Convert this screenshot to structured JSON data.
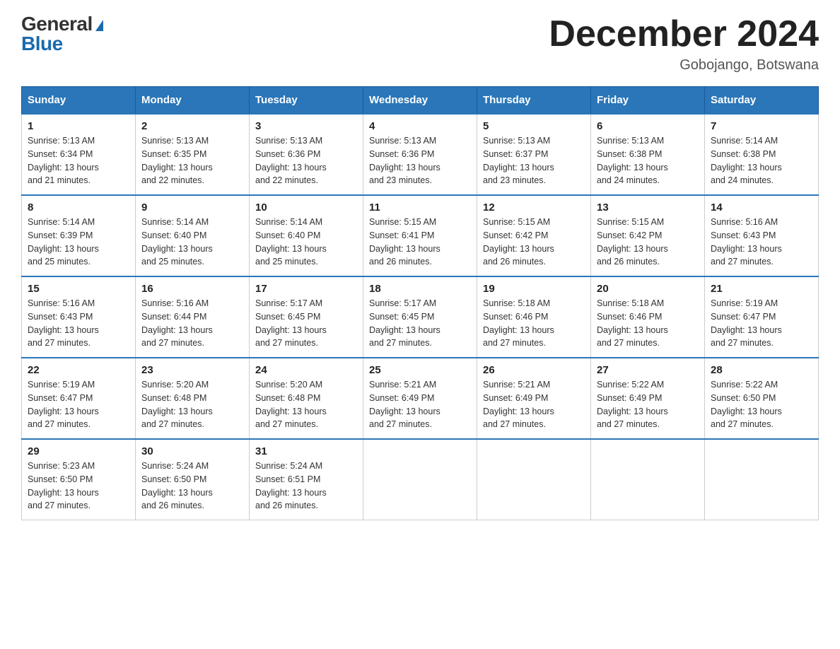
{
  "logo": {
    "general": "General",
    "blue": "Blue"
  },
  "title": "December 2024",
  "subtitle": "Gobojango, Botswana",
  "days_header": [
    "Sunday",
    "Monday",
    "Tuesday",
    "Wednesday",
    "Thursday",
    "Friday",
    "Saturday"
  ],
  "weeks": [
    [
      {
        "day": "1",
        "sunrise": "5:13 AM",
        "sunset": "6:34 PM",
        "daylight": "13 hours and 21 minutes."
      },
      {
        "day": "2",
        "sunrise": "5:13 AM",
        "sunset": "6:35 PM",
        "daylight": "13 hours and 22 minutes."
      },
      {
        "day": "3",
        "sunrise": "5:13 AM",
        "sunset": "6:36 PM",
        "daylight": "13 hours and 22 minutes."
      },
      {
        "day": "4",
        "sunrise": "5:13 AM",
        "sunset": "6:36 PM",
        "daylight": "13 hours and 23 minutes."
      },
      {
        "day": "5",
        "sunrise": "5:13 AM",
        "sunset": "6:37 PM",
        "daylight": "13 hours and 23 minutes."
      },
      {
        "day": "6",
        "sunrise": "5:13 AM",
        "sunset": "6:38 PM",
        "daylight": "13 hours and 24 minutes."
      },
      {
        "day": "7",
        "sunrise": "5:14 AM",
        "sunset": "6:38 PM",
        "daylight": "13 hours and 24 minutes."
      }
    ],
    [
      {
        "day": "8",
        "sunrise": "5:14 AM",
        "sunset": "6:39 PM",
        "daylight": "13 hours and 25 minutes."
      },
      {
        "day": "9",
        "sunrise": "5:14 AM",
        "sunset": "6:40 PM",
        "daylight": "13 hours and 25 minutes."
      },
      {
        "day": "10",
        "sunrise": "5:14 AM",
        "sunset": "6:40 PM",
        "daylight": "13 hours and 25 minutes."
      },
      {
        "day": "11",
        "sunrise": "5:15 AM",
        "sunset": "6:41 PM",
        "daylight": "13 hours and 26 minutes."
      },
      {
        "day": "12",
        "sunrise": "5:15 AM",
        "sunset": "6:42 PM",
        "daylight": "13 hours and 26 minutes."
      },
      {
        "day": "13",
        "sunrise": "5:15 AM",
        "sunset": "6:42 PM",
        "daylight": "13 hours and 26 minutes."
      },
      {
        "day": "14",
        "sunrise": "5:16 AM",
        "sunset": "6:43 PM",
        "daylight": "13 hours and 27 minutes."
      }
    ],
    [
      {
        "day": "15",
        "sunrise": "5:16 AM",
        "sunset": "6:43 PM",
        "daylight": "13 hours and 27 minutes."
      },
      {
        "day": "16",
        "sunrise": "5:16 AM",
        "sunset": "6:44 PM",
        "daylight": "13 hours and 27 minutes."
      },
      {
        "day": "17",
        "sunrise": "5:17 AM",
        "sunset": "6:45 PM",
        "daylight": "13 hours and 27 minutes."
      },
      {
        "day": "18",
        "sunrise": "5:17 AM",
        "sunset": "6:45 PM",
        "daylight": "13 hours and 27 minutes."
      },
      {
        "day": "19",
        "sunrise": "5:18 AM",
        "sunset": "6:46 PM",
        "daylight": "13 hours and 27 minutes."
      },
      {
        "day": "20",
        "sunrise": "5:18 AM",
        "sunset": "6:46 PM",
        "daylight": "13 hours and 27 minutes."
      },
      {
        "day": "21",
        "sunrise": "5:19 AM",
        "sunset": "6:47 PM",
        "daylight": "13 hours and 27 minutes."
      }
    ],
    [
      {
        "day": "22",
        "sunrise": "5:19 AM",
        "sunset": "6:47 PM",
        "daylight": "13 hours and 27 minutes."
      },
      {
        "day": "23",
        "sunrise": "5:20 AM",
        "sunset": "6:48 PM",
        "daylight": "13 hours and 27 minutes."
      },
      {
        "day": "24",
        "sunrise": "5:20 AM",
        "sunset": "6:48 PM",
        "daylight": "13 hours and 27 minutes."
      },
      {
        "day": "25",
        "sunrise": "5:21 AM",
        "sunset": "6:49 PM",
        "daylight": "13 hours and 27 minutes."
      },
      {
        "day": "26",
        "sunrise": "5:21 AM",
        "sunset": "6:49 PM",
        "daylight": "13 hours and 27 minutes."
      },
      {
        "day": "27",
        "sunrise": "5:22 AM",
        "sunset": "6:49 PM",
        "daylight": "13 hours and 27 minutes."
      },
      {
        "day": "28",
        "sunrise": "5:22 AM",
        "sunset": "6:50 PM",
        "daylight": "13 hours and 27 minutes."
      }
    ],
    [
      {
        "day": "29",
        "sunrise": "5:23 AM",
        "sunset": "6:50 PM",
        "daylight": "13 hours and 27 minutes."
      },
      {
        "day": "30",
        "sunrise": "5:24 AM",
        "sunset": "6:50 PM",
        "daylight": "13 hours and 26 minutes."
      },
      {
        "day": "31",
        "sunrise": "5:24 AM",
        "sunset": "6:51 PM",
        "daylight": "13 hours and 26 minutes."
      },
      null,
      null,
      null,
      null
    ]
  ],
  "labels": {
    "sunrise": "Sunrise:",
    "sunset": "Sunset:",
    "daylight": "Daylight:"
  }
}
